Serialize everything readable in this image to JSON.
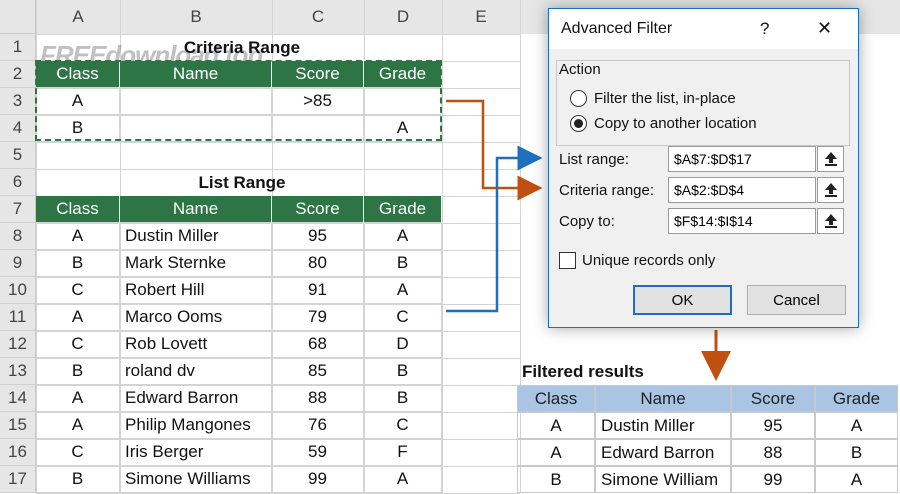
{
  "columns": [
    "A",
    "B",
    "C",
    "D",
    "E"
  ],
  "rows": [
    "1",
    "2",
    "3",
    "4",
    "5",
    "6",
    "7",
    "8",
    "9",
    "10",
    "11",
    "12",
    "13",
    "14",
    "15",
    "16",
    "17"
  ],
  "watermark": "FREEdownload.top",
  "criteria": {
    "title": "Criteria Range",
    "headers": [
      "Class",
      "Name",
      "Score",
      "Grade"
    ],
    "rows": [
      [
        "A",
        "",
        ">85",
        ""
      ],
      [
        "B",
        "",
        "",
        "A"
      ]
    ]
  },
  "list": {
    "title": "List Range",
    "headers": [
      "Class",
      "Name",
      "Score",
      "Grade"
    ],
    "rows": [
      [
        "A",
        "Dustin Miller",
        "95",
        "A"
      ],
      [
        "B",
        "Mark Sternke",
        "80",
        "B"
      ],
      [
        "C",
        "Robert Hill",
        "91",
        "A"
      ],
      [
        "A",
        "Marco Ooms",
        "79",
        "C"
      ],
      [
        "C",
        "Rob Lovett",
        "68",
        "D"
      ],
      [
        "B",
        "roland dv",
        "85",
        "B"
      ],
      [
        "A",
        "Edward Barron",
        "88",
        "B"
      ],
      [
        "A",
        "Philip Mangones",
        "76",
        "C"
      ],
      [
        "C",
        "Iris Berger",
        "59",
        "F"
      ],
      [
        "B",
        "Simone Williams",
        "99",
        "A"
      ]
    ]
  },
  "results": {
    "title": "Filtered results",
    "headers": [
      "Class",
      "Name",
      "Score",
      "Grade"
    ],
    "rows": [
      [
        "A",
        "Dustin Miller",
        "95",
        "A"
      ],
      [
        "A",
        "Edward Barron",
        "88",
        "B"
      ],
      [
        "B",
        "Simone William",
        "99",
        "A"
      ]
    ]
  },
  "dialog": {
    "title": "Advanced Filter",
    "help": "?",
    "close": "✕",
    "action_label": "Action",
    "option_filter": "Filter the list, in-place",
    "option_copy": "Copy to another location",
    "list_range_label": "List range:",
    "list_range_value": "$A$7:$D$17",
    "criteria_range_label": "Criteria range:",
    "criteria_range_value": "$A$2:$D$4",
    "copy_to_label": "Copy to:",
    "copy_to_value": "$F$14:$I$14",
    "unique_label": "Unique records only",
    "ok": "OK",
    "cancel": "Cancel"
  },
  "colors": {
    "green_header": "#2e7546",
    "blue_header": "#aac4e4",
    "arrow_blue": "#1f6fbf",
    "arrow_orange": "#c0500f",
    "dialog_border": "#1a6fc0"
  }
}
